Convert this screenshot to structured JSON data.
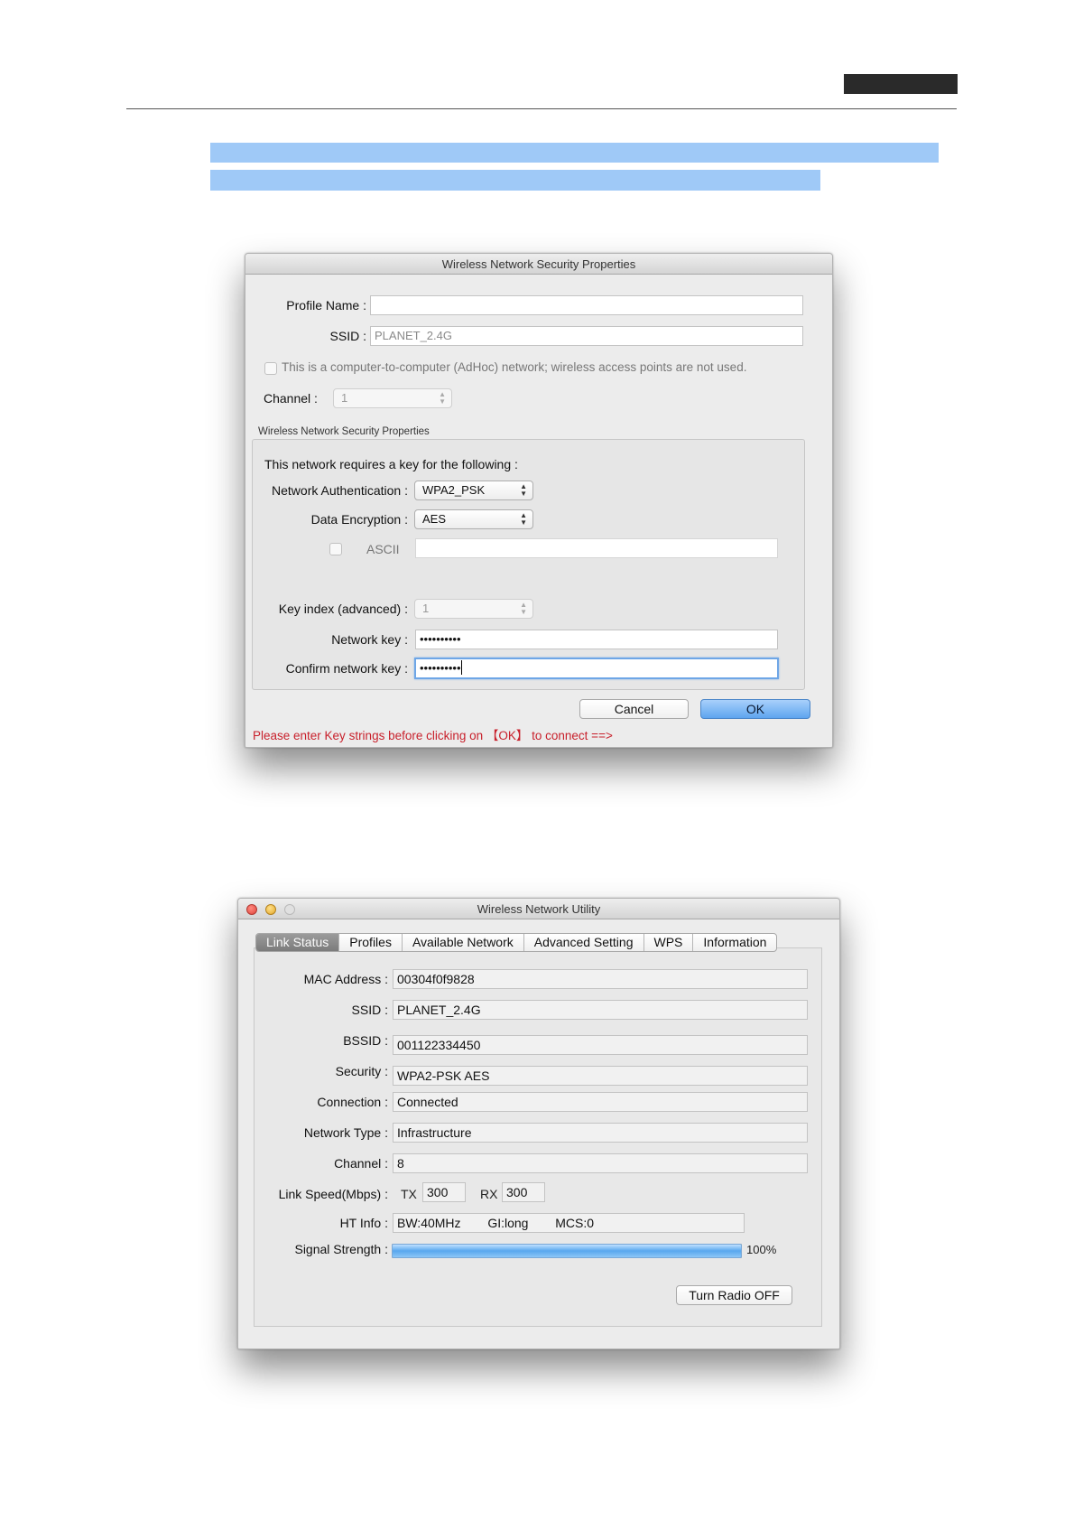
{
  "dialog": {
    "title": "Wireless Network Security Properties",
    "profile_name_label": "Profile Name :",
    "profile_name_value": "",
    "ssid_label": "SSID :",
    "ssid_value": "PLANET_2.4G",
    "adhoc_text": "This is a computer-to-computer (AdHoc) network; wireless access points are not used.",
    "channel_label": "Channel :",
    "channel_value": "1",
    "group_title": "Wireless Network Security Properties",
    "requires_text": "This network requires a key for the following :",
    "auth_label": "Network Authentication :",
    "auth_value": "WPA2_PSK",
    "encryption_label": "Data Encryption :",
    "encryption_value": "AES",
    "ascii_label": "ASCII",
    "key_index_label": "Key index (advanced) :",
    "key_index_value": "1",
    "network_key_label": "Network key :",
    "network_key_value": "••••••••••",
    "confirm_key_label": "Confirm network key :",
    "confirm_key_value": "••••••••••",
    "cancel_label": "Cancel",
    "ok_label": "OK",
    "warning_text": "Please enter Key strings before clicking on 【OK】 to connect ==>"
  },
  "utility": {
    "title": "Wireless Network Utility",
    "tabs": [
      {
        "label": "Link Status"
      },
      {
        "label": "Profiles"
      },
      {
        "label": "Available Network"
      },
      {
        "label": "Advanced Setting"
      },
      {
        "label": "WPS"
      },
      {
        "label": "Information"
      }
    ],
    "mac_label": "MAC Address :",
    "mac_value": "00304f0f9828",
    "ssid_label": "SSID :",
    "ssid_value": "PLANET_2.4G",
    "bssid_label": "BSSID :",
    "bssid_value": "001122334450",
    "security_label": "Security :",
    "security_value": "WPA2-PSK AES",
    "connection_label": "Connection :",
    "connection_value": "Connected",
    "network_type_label": "Network Type :",
    "network_type_value": "Infrastructure",
    "channel_label": "Channel :",
    "channel_value": "8",
    "link_speed_label": "Link Speed(Mbps) :",
    "tx_label": "TX",
    "tx_value": "300",
    "rx_label": "RX",
    "rx_value": "300",
    "ht_info_label": "HT Info :",
    "ht_bw": "BW:40MHz",
    "ht_gi": "GI:long",
    "ht_mcs": "MCS:0",
    "signal_label": "Signal Strength :",
    "signal_percent": 100,
    "signal_text": "100%",
    "radio_button_label": "Turn Radio OFF"
  }
}
